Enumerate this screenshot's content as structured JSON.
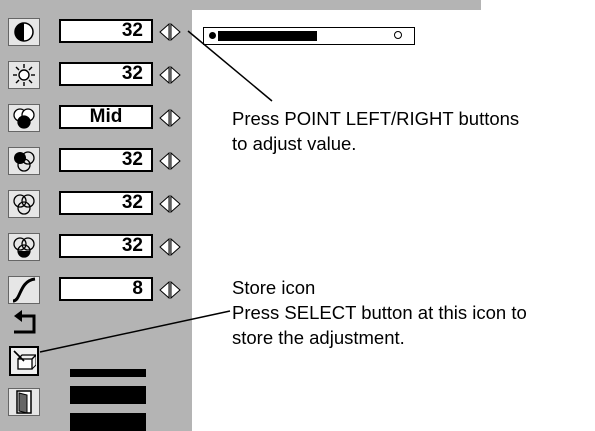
{
  "menu": {
    "rows": [
      {
        "name": "contrast",
        "value": "32"
      },
      {
        "name": "brightness",
        "value": "32"
      },
      {
        "name": "color-temp",
        "value": "Mid"
      },
      {
        "name": "red",
        "value": "32"
      },
      {
        "name": "green",
        "value": "32"
      },
      {
        "name": "blue",
        "value": "32"
      },
      {
        "name": "gamma",
        "value": "8"
      }
    ]
  },
  "slider": {
    "level_fraction": 0.5
  },
  "annotations": {
    "adjust_line1": "Press POINT LEFT/RIGHT buttons",
    "adjust_line2": "to adjust value.",
    "store_title": "Store icon",
    "store_line1": "Press SELECT button at this icon to",
    "store_line2": "store the adjustment."
  },
  "icons": {
    "contrast": "contrast-icon",
    "brightness": "brightness-icon",
    "color_temp": "color-temp-icon",
    "red": "red-icon",
    "green": "green-icon",
    "blue": "blue-icon",
    "gamma": "gamma-icon",
    "reset": "reset-icon",
    "store": "store-icon",
    "exit": "exit-icon"
  },
  "colors": {
    "panel": "#b4b4b4",
    "icon_bg": "#e6e6e6"
  }
}
